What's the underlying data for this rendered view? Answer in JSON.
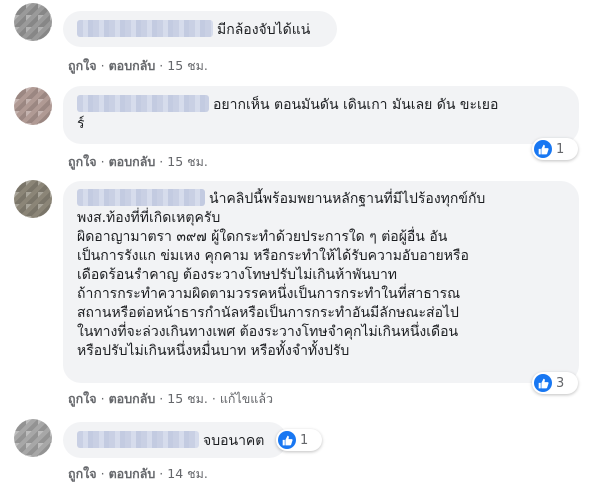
{
  "comments": [
    {
      "text": "มีกล้องจับได้แน่",
      "actions": {
        "like": "ถูกใจ",
        "reply": "ตอบกลับ",
        "time": "15 ชม."
      }
    },
    {
      "text": "อยากเห็น ตอนมันดัน เดินเกา มันเลย ดัน ขะเยอ\nร์",
      "actions": {
        "like": "ถูกใจ",
        "reply": "ตอบกลับ",
        "time": "15 ชม."
      },
      "reactions": {
        "count": "1"
      }
    },
    {
      "text": "นำคลิปนี้พร้อมพยานหลักฐานที่มีไปร้องทุกข์กับ\nพงส.ท้องที่ที่เกิดเหตุครับ\nผิดอาญามาตรา ๓๙๗ ผู้ใดกระทำด้วยประการใด ๆ ต่อผู้อื่น อัน\nเป็นการรังแก ข่มเหง คุกคาม หรือกระทำให้ได้รับความอับอายหรือ\nเดือดร้อนรำคาญ ต้องระวางโทษปรับไม่เกินห้าพันบาท\nถ้าการกระทำความผิดตามวรรคหนึ่งเป็นการกระทำในที่สาธารณ\nสถานหรือต่อหน้าธารกำนัลหรือเป็นการกระทำอันมีลักษณะส่อไป\nในทางที่จะล่วงเกินทางเพศ ต้องระวางโทษจำคุกไม่เกินหนึ่งเดือน\nหรือปรับไม่เกินหนึ่งหมื่นบาท หรือทั้งจำทั้งปรับ",
      "actions": {
        "like": "ถูกใจ",
        "reply": "ตอบกลับ",
        "time": "15 ชม.",
        "edited": "แก้ไขแล้ว"
      },
      "reactions": {
        "count": "3"
      }
    },
    {
      "text": "จบอนาคต",
      "actions": {
        "like": "ถูกใจ",
        "reply": "ตอบกลับ",
        "time": "14 ชม."
      },
      "reactions": {
        "count": "1"
      }
    }
  ],
  "colors": {
    "bubble": "#f2f3f5",
    "like_blue": "#1877f2",
    "meta": "#65676b"
  },
  "icons": {
    "reaction": "like-thumbs-up-icon"
  }
}
